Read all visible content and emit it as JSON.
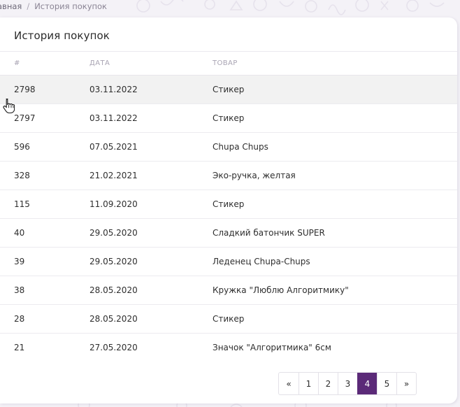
{
  "breadcrumb": {
    "home": "авная",
    "separator": "/",
    "current": "История покупок"
  },
  "card": {
    "title": "История покупок"
  },
  "table": {
    "headers": [
      "#",
      "ДАТА",
      "ТОВАР"
    ],
    "rows": [
      {
        "num": "2798",
        "date": "03.11.2022",
        "item": "Стикер"
      },
      {
        "num": "2797",
        "date": "03.11.2022",
        "item": "Стикер"
      },
      {
        "num": "596",
        "date": "07.05.2021",
        "item": "Chupa Chups"
      },
      {
        "num": "328",
        "date": "21.02.2021",
        "item": "Эко-ручка, желтая"
      },
      {
        "num": "115",
        "date": "11.09.2020",
        "item": "Стикер"
      },
      {
        "num": "40",
        "date": "29.05.2020",
        "item": "Сладкий батончик SUPER"
      },
      {
        "num": "39",
        "date": "29.05.2020",
        "item": "Леденец Chupa-Chups"
      },
      {
        "num": "38",
        "date": "28.05.2020",
        "item": "Кружка \"Люблю Алгоритмику\""
      },
      {
        "num": "28",
        "date": "28.05.2020",
        "item": "Стикер"
      },
      {
        "num": "21",
        "date": "27.05.2020",
        "item": "Значок \"Алгоритмика\" 6см"
      }
    ]
  },
  "pagination": {
    "prev": "«",
    "pages": [
      "1",
      "2",
      "3",
      "4",
      "5"
    ],
    "next": "»",
    "active_page": "4"
  },
  "colors": {
    "accent": "#5b2a78",
    "hover_row": "#f2f2f2",
    "background": "#f4f2f7"
  },
  "icons": {
    "cursor": "hand-pointer-icon"
  }
}
